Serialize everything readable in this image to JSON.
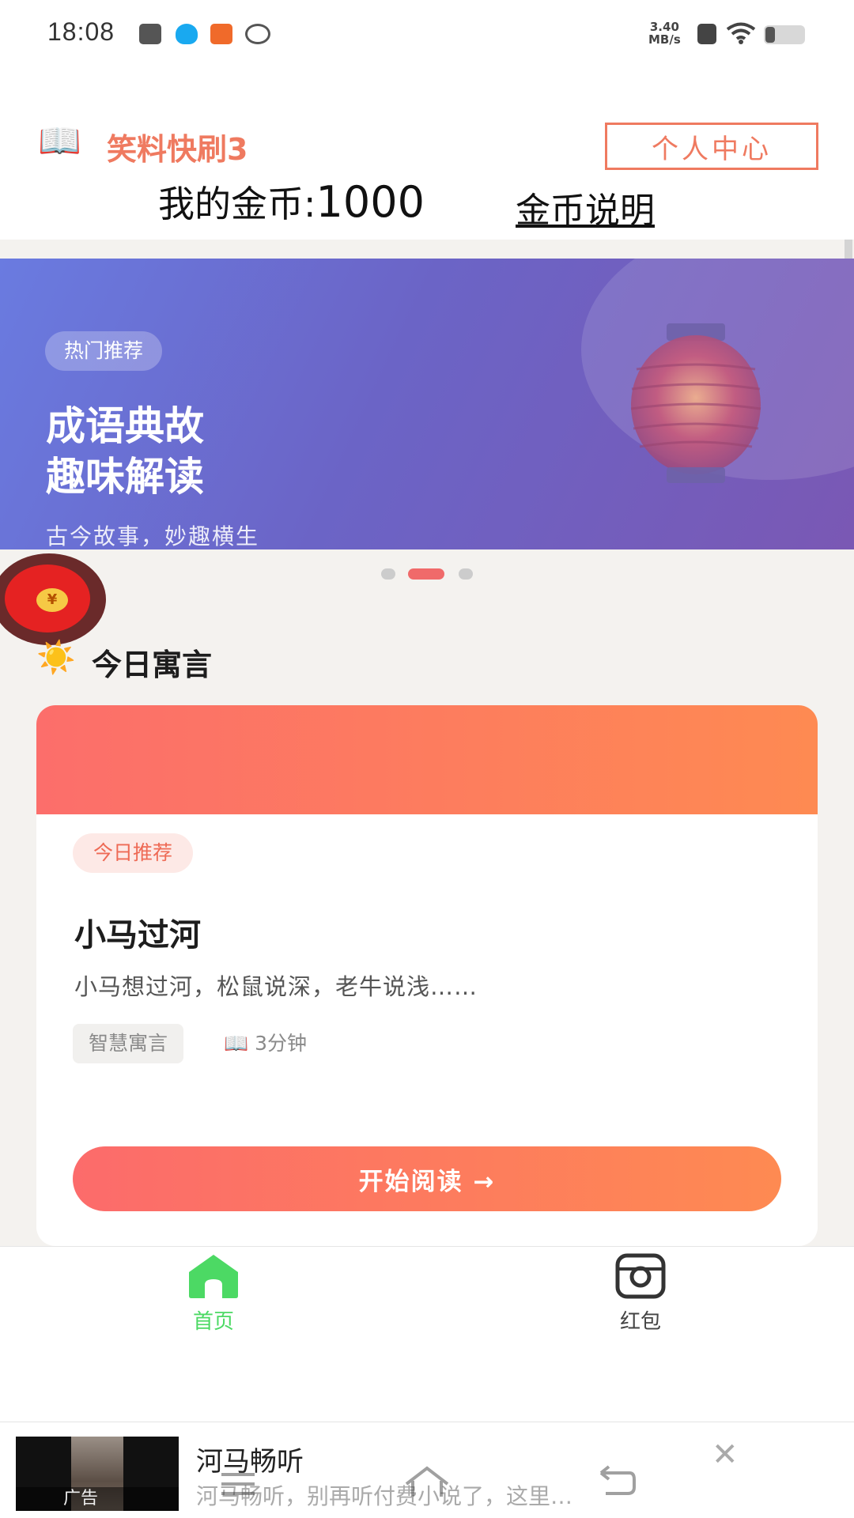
{
  "status_bar": {
    "time": "18:08",
    "net_speed_value": "3.40",
    "net_speed_unit": "MB/s"
  },
  "header": {
    "app_icon": "open-book-icon",
    "app_title": "笑料快刷3",
    "profile_button": "个人中心",
    "coins_label": "我的金币:",
    "coins_value": "1000",
    "coin_info_link": "金币说明"
  },
  "banner": {
    "tag": "热门推荐",
    "title_line1": "成语典故",
    "title_line2": "趣味解读",
    "subtitle": "古今故事，妙趣横生",
    "active_slide": 2,
    "slide_count": 3
  },
  "section": {
    "icon": "sun-icon",
    "title": "今日寓言"
  },
  "card": {
    "tag": "今日推荐",
    "title": "小马过河",
    "excerpt": "小马想过河，松鼠说深，老牛说浅……",
    "category": "智慧寓言",
    "read_time": "📖 3分钟",
    "start_button": "开始阅读 →"
  },
  "floating_redpacket": {
    "symbol": "¥"
  },
  "bottom_nav": {
    "items": [
      {
        "label": "首页",
        "icon": "home-icon",
        "active": true
      },
      {
        "label": "红包",
        "icon": "camera-icon",
        "active": false
      }
    ]
  },
  "ad": {
    "badge": "广告",
    "title": "河马畅听",
    "description": "河马畅听，别再听付费小说了，这里…"
  },
  "colors": {
    "accent": "#ef7a60",
    "nav_active": "#4cd964",
    "button_start": "#fc6b6b",
    "button_end": "#fe8a52"
  }
}
